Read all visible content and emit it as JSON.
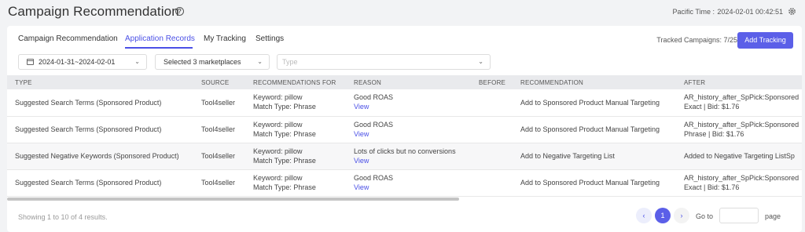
{
  "header": {
    "title": "Campaign Recommendation",
    "timezone_label": "Pacific Time :",
    "timezone_value": "2024-02-01 00:42:51"
  },
  "tabs": [
    {
      "label": "Campaign Recommendation",
      "active": false
    },
    {
      "label": "Application Records",
      "active": true
    },
    {
      "label": "My Tracking",
      "active": false
    },
    {
      "label": "Settings",
      "active": false
    }
  ],
  "tracked": {
    "label": "Tracked Campaigns: 7/25",
    "button": "Add Tracking"
  },
  "filters": {
    "date_range": "2024-01-31~2024-02-01",
    "marketplaces": "Selected 3 marketplaces",
    "type_placeholder": "Type"
  },
  "table": {
    "columns": [
      "TYPE",
      "SOURCE",
      "RECOMMENDATIONS FOR",
      "REASON",
      "BEFORE",
      "RECOMMENDATION",
      "AFTER"
    ],
    "rows": [
      {
        "type": "Suggested Search Terms (Sponsored Product)",
        "source": "Tool4seller",
        "keyword": "Keyword: pillow",
        "match": "Match Type: Phrase",
        "reason": "Good ROAS",
        "view": "View",
        "before": "",
        "recommendation": "Add to Sponsored Product Manual Targeting",
        "after1": "AR_history_after_SpPick:Sponsored",
        "after2": "Exact | Bid: $1.76"
      },
      {
        "type": "Suggested Search Terms (Sponsored Product)",
        "source": "Tool4seller",
        "keyword": "Keyword: pillow",
        "match": "Match Type: Phrase",
        "reason": "Good ROAS",
        "view": "View",
        "before": "",
        "recommendation": "Add to Sponsored Product Manual Targeting",
        "after1": "AR_history_after_SpPick:Sponsored",
        "after2": "Phrase | Bid: $1.76"
      },
      {
        "type": "Suggested Negative Keywords (Sponsored Product)",
        "source": "Tool4seller",
        "keyword": "Keyword: pillow",
        "match": "Match Type: Phrase",
        "reason": "Lots of clicks but no conversions",
        "view": "View",
        "before": "",
        "recommendation": "Add to Negative Targeting List",
        "after1": "Added to Negative Targeting ListSp",
        "after2": ""
      },
      {
        "type": "Suggested Search Terms (Sponsored Product)",
        "source": "Tool4seller",
        "keyword": "Keyword: pillow",
        "match": "Match Type: Phrase",
        "reason": "Good ROAS",
        "view": "View",
        "before": "",
        "recommendation": "Add to Sponsored Product Manual Targeting",
        "after1": "AR_history_after_SpPick:Sponsored",
        "after2": "Exact | Bid: $1.76"
      }
    ]
  },
  "footer": {
    "summary": "Showing 1 to 10 of 4 results.",
    "prev": "‹",
    "current_page": "1",
    "next": "›",
    "goto": "Go to",
    "page": "page"
  },
  "colors": {
    "accent": "#5b5fe8",
    "link": "#4b50e6"
  }
}
